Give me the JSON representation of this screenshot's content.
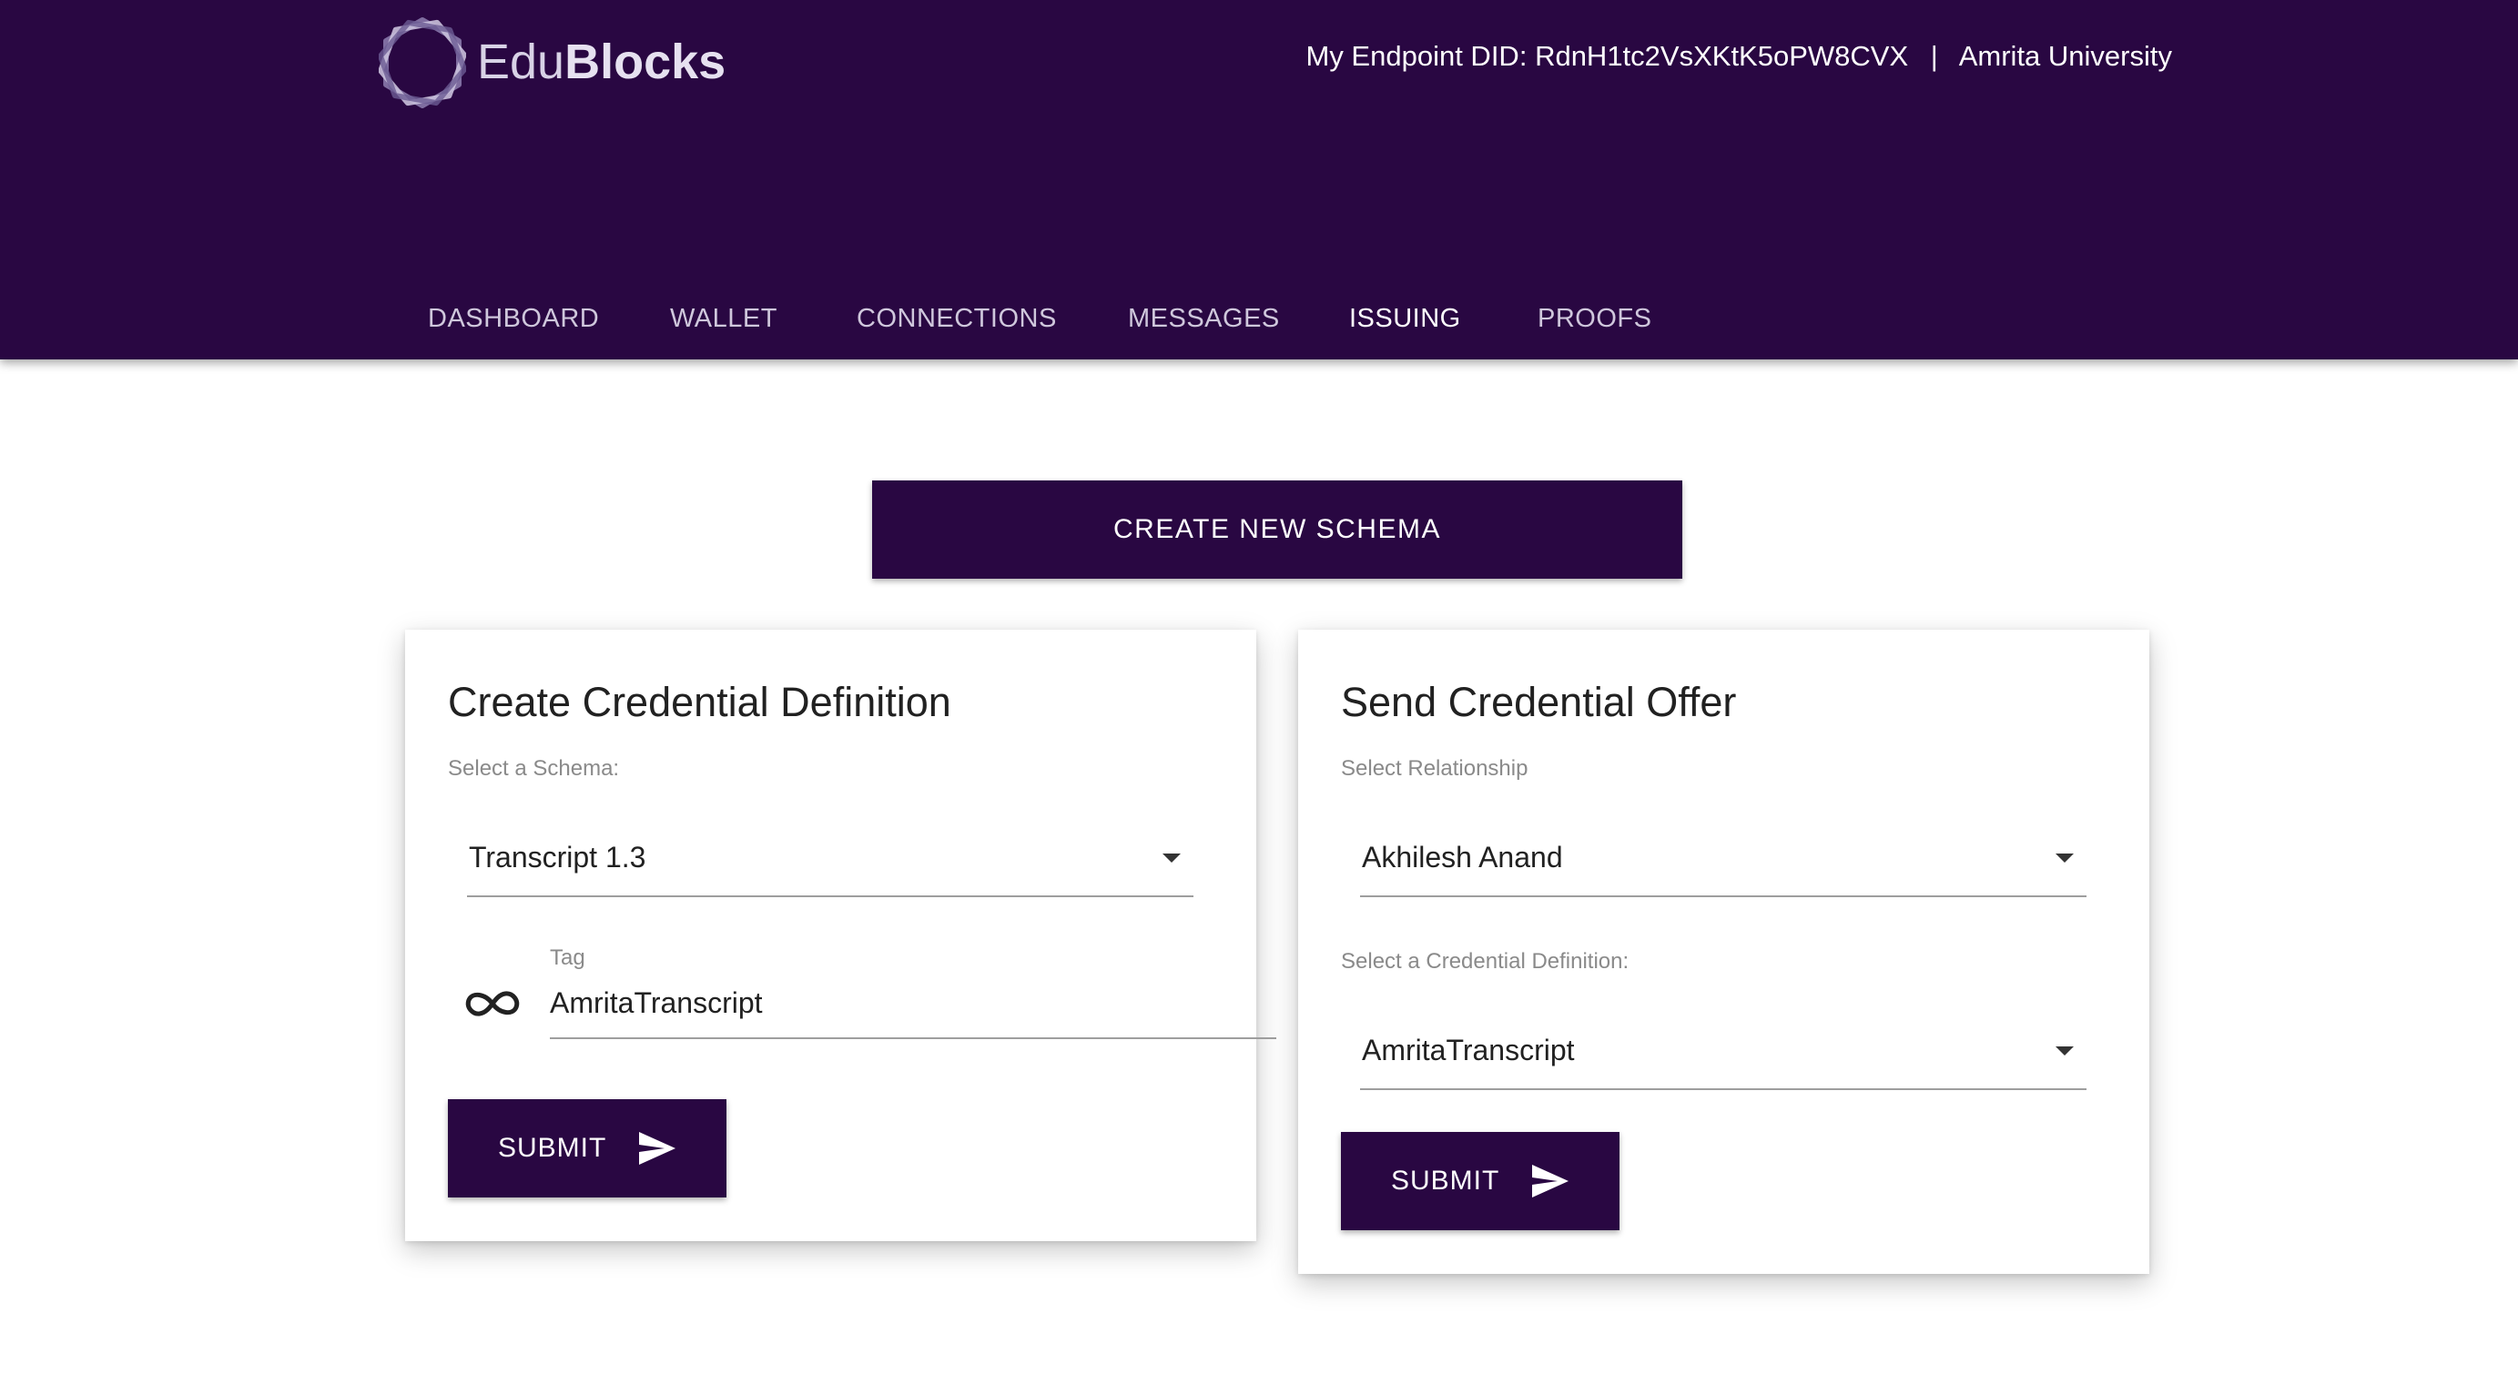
{
  "brand": {
    "name_light": "Edu",
    "name_bold": "Blocks"
  },
  "header": {
    "endpoint_label": "My Endpoint DID:",
    "endpoint_did": "RdnH1tc2VsXKtK5oPW8CVX",
    "separator": "|",
    "organization": "Amrita University"
  },
  "nav": {
    "tabs": [
      {
        "label": "DASHBOARD"
      },
      {
        "label": "WALLET"
      },
      {
        "label": "CONNECTIONS"
      },
      {
        "label": "MESSAGES"
      },
      {
        "label": "ISSUING"
      },
      {
        "label": "PROOFS"
      }
    ],
    "active": "ISSUING"
  },
  "main": {
    "create_schema_label": "CREATE NEW SCHEMA",
    "credential_definition": {
      "title": "Create Credential Definition",
      "schema_label": "Select a Schema:",
      "schema_value": "Transcript 1.3",
      "tag_label": "Tag",
      "tag_value": "AmritaTranscript",
      "submit_label": "SUBMIT"
    },
    "credential_offer": {
      "title": "Send Credential Offer",
      "relationship_label": "Select Relationship",
      "relationship_value": "Akhilesh Anand",
      "definition_label": "Select a Credential Definition:",
      "definition_value": "AmritaTranscript",
      "submit_label": "SUBMIT"
    }
  },
  "colors": {
    "primary": "#290742",
    "background": "#ffffff",
    "underline": "#9e9e9e"
  },
  "icons": {
    "logo": "hexagon-logo-icon",
    "tag": "infinity-icon",
    "submit": "send-icon",
    "dropdown": "caret-down-icon"
  }
}
